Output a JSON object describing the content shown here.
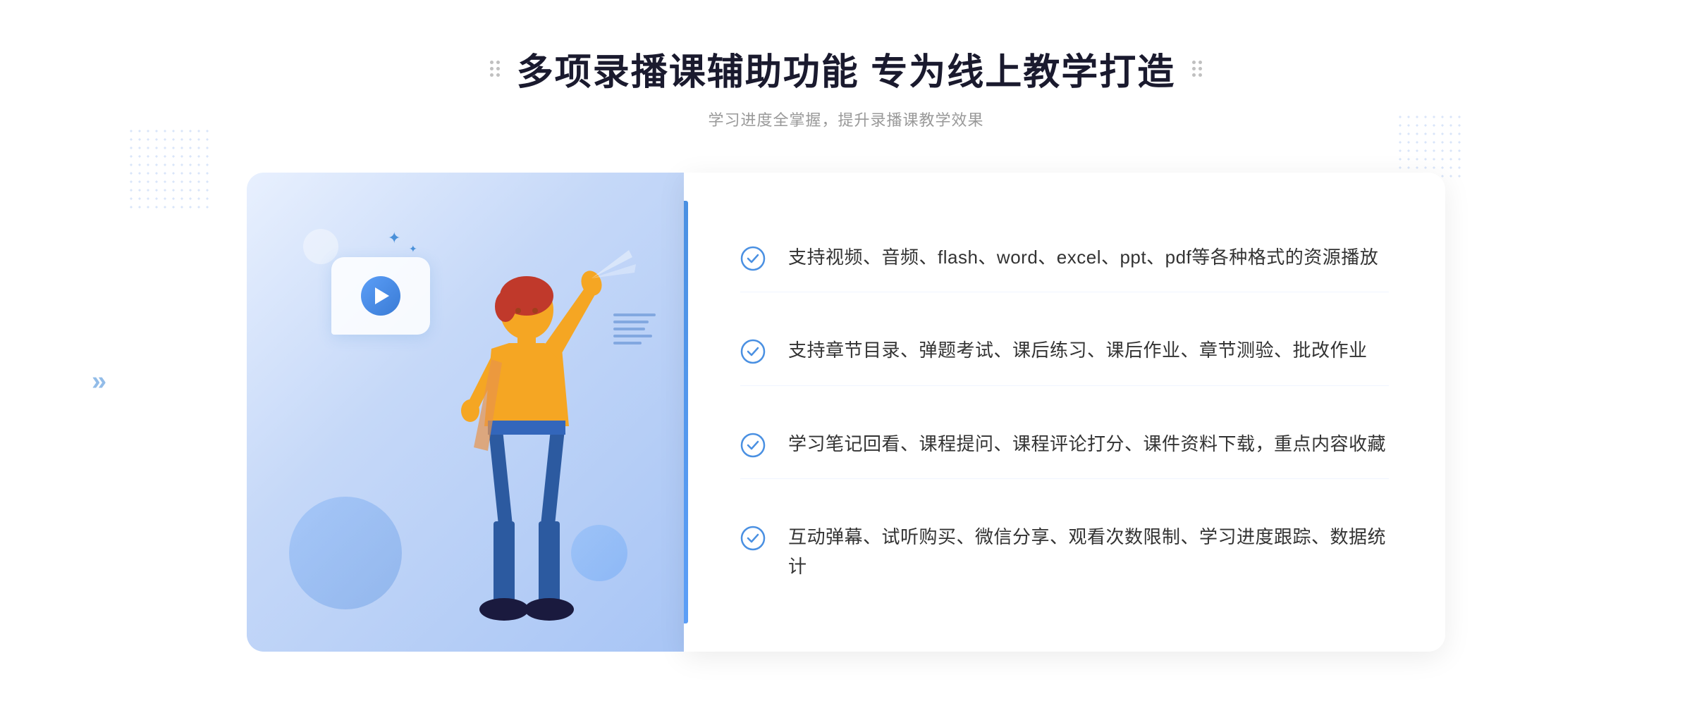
{
  "page": {
    "background": "#ffffff"
  },
  "header": {
    "main_title": "多项录播课辅助功能 专为线上教学打造",
    "subtitle": "学习进度全掌握，提升录播课教学效果"
  },
  "features": [
    {
      "id": 1,
      "text": "支持视频、音频、flash、word、excel、ppt、pdf等各种格式的资源播放"
    },
    {
      "id": 2,
      "text": "支持章节目录、弹题考试、课后练习、课后作业、章节测验、批改作业"
    },
    {
      "id": 3,
      "text": "学习笔记回看、课程提问、课程评论打分、课件资料下载，重点内容收藏"
    },
    {
      "id": 4,
      "text": "互动弹幕、试听购买、微信分享、观看次数限制、学习进度跟踪、数据统计"
    }
  ],
  "decorative": {
    "arrow_left": "»",
    "sparkles": "✦"
  }
}
